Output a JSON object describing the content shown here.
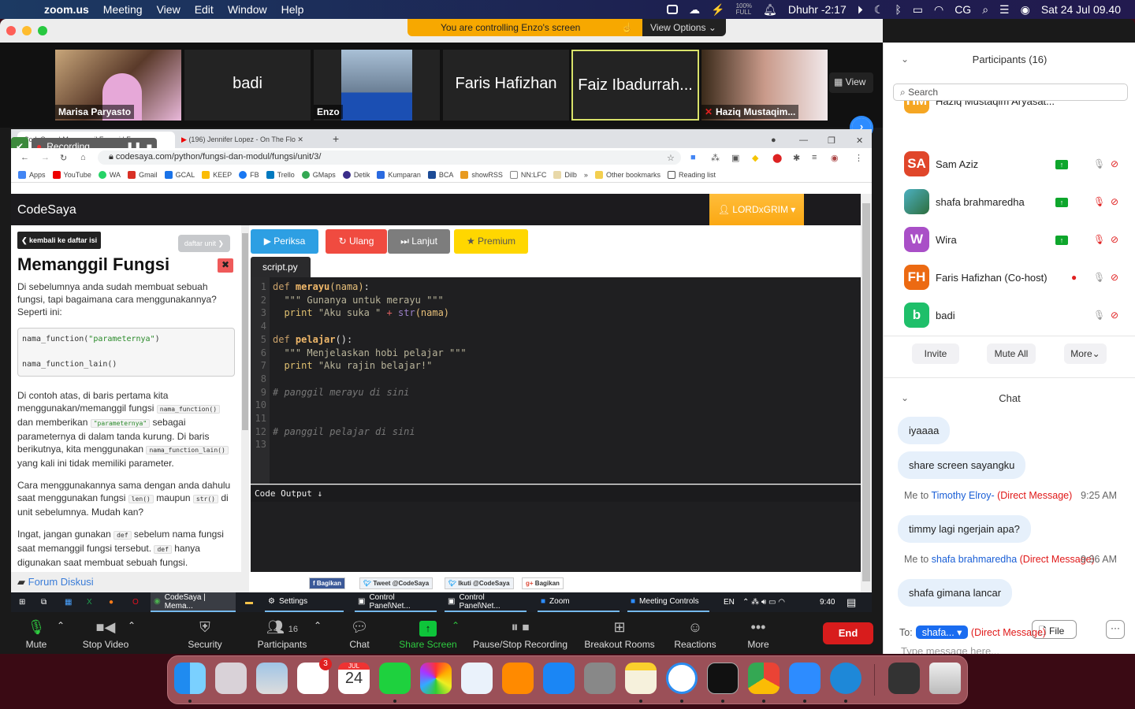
{
  "menubar": {
    "app": "zoom.us",
    "items": [
      "Meeting",
      "View",
      "Edit",
      "Window",
      "Help"
    ],
    "battery_small": [
      "100%",
      "FULL"
    ],
    "prayer": "Dhuhr -2:17",
    "user_initials": "CG",
    "datetime": "Sat 24 Jul  09.40"
  },
  "zoom": {
    "control_banner": "You are controlling Enzo's screen",
    "view_options": "View Options",
    "view_button": "View",
    "gallery": [
      {
        "name": "Marisa Paryasto",
        "type": "video"
      },
      {
        "name": "badi",
        "type": "name"
      },
      {
        "name": "Enzo",
        "type": "image"
      },
      {
        "name": "Faris Hafizhan",
        "type": "name"
      },
      {
        "name": "Faiz Ibadurrah...",
        "type": "name",
        "active": true
      },
      {
        "name": "Haziq Mustaqim...",
        "type": "video",
        "muted": true
      }
    ],
    "controls": {
      "mute": "Mute",
      "stop_video": "Stop Video",
      "security": "Security",
      "participants": "Participants",
      "participants_count": "16",
      "chat": "Chat",
      "share_screen": "Share Screen",
      "recording": "Pause/Stop Recording",
      "breakout": "Breakout Rooms",
      "reactions": "Reactions",
      "more": "More",
      "end": "End"
    }
  },
  "browser": {
    "tabs": [
      {
        "title": "CodeSaya | Memanggil Fungsi | F"
      },
      {
        "title": "(196) Jennifer Lopez - On The Flo"
      }
    ],
    "recording": "Recording...",
    "url": "codesaya.com/python/fungsi-dan-modul/fungsi/unit/3/",
    "bookmarks": [
      "Apps",
      "YouTube",
      "WA",
      "Gmail",
      "GCAL",
      "KEEP",
      "FB",
      "Trello",
      "GMaps",
      "Detik",
      "Kumparan",
      "BCA",
      "showRSS",
      "NN:LFC",
      "Dilb",
      "»",
      "Other bookmarks",
      "Reading list"
    ]
  },
  "codesaya": {
    "brand": "CodeSaya",
    "user": "LORDxGRIM",
    "back": "❮ kembali ke daftar isi",
    "unit_list": "daftar unit ❯",
    "title": "Memanggil Fungsi",
    "p1": "Di sebelumnya anda sudah membuat sebuah fungsi, tapi bagaimana cara menggunakannya? Seperti ini:",
    "example_line1_fn": "nama_function(",
    "example_line1_str": "\"parameternya\"",
    "example_line1_end": ")",
    "example_line2": "nama_function_lain()",
    "p2_a": "Di contoh atas, di baris pertama kita menggunakan/memanggil fungsi ",
    "p2_code1": "nama_function()",
    "p2_b": " dan memberikan ",
    "p2_code2": "\"parameternya\"",
    "p2_c": " sebagai parameternya di dalam tanda kurung. Di baris berikutnya, kita menggunakan ",
    "p2_code3": "nama_function_lain()",
    "p2_d": " yang kali ini tidak memiliki parameter.",
    "p3_a": "Cara menggunakannya sama dengan anda dahulu saat menggunakan fungsi ",
    "p3_code1": "len()",
    "p3_b": " maupun ",
    "p3_code2": "str()",
    "p3_c": " di unit sebelumnya. Mudah kan?",
    "p4_a": "Ingat, jangan gunakan ",
    "p4_code1": "def",
    "p4_b": " sebelum nama fungsi saat memanggil fungsi tersebut. ",
    "p4_code2": "def",
    "p4_c": " hanya digunakan saat membuat sebuah fungsi.",
    "forum": "Forum Diskusi",
    "buttons": {
      "check": "▶ Periksa",
      "reset": "↻ Ulang",
      "next": "⏭ Lanjut",
      "premium": "★ Premium"
    },
    "file_tab": "script.py",
    "line_numbers": [
      "1",
      "2",
      "3",
      "4",
      "5",
      "6",
      "7",
      "8",
      "9",
      "10",
      "11",
      "12",
      "13"
    ],
    "output_header": "Code Output ↓",
    "share": [
      "Bagikan",
      "Tweet @CodeSaya",
      "Ikuti @CodeSaya",
      "Bagikan"
    ]
  },
  "taskbar": {
    "items": [
      "CodeSaya | Mema...",
      "Settings",
      "Control Panel\\Net...",
      "Control Panel\\Net...",
      "Zoom",
      "Meeting Controls"
    ],
    "lang": "EN",
    "time": "9:40"
  },
  "participants": {
    "title": "Participants (16)",
    "search_placeholder": "Search",
    "list": [
      {
        "initials": "HM",
        "name": "Haziq Mustaqim Aryasat...",
        "color": "#f5a623"
      },
      {
        "initials": "SA",
        "name": "Sam Aziz",
        "color": "#e0462a"
      },
      {
        "initials": "",
        "name": "shafa brahmaredha",
        "color": "#3aa0a0"
      },
      {
        "initials": "W",
        "name": "Wira",
        "color": "#a94fc7"
      },
      {
        "initials": "FH",
        "name": "Faris Hafizhan (Co-host)",
        "color": "#ec6a12"
      },
      {
        "initials": "b",
        "name": "badi",
        "color": "#1fbf6a"
      }
    ],
    "buttons": {
      "invite": "Invite",
      "mute_all": "Mute All",
      "more": "More"
    }
  },
  "chat": {
    "title": "Chat",
    "messages": [
      {
        "text": "iyaaaa"
      },
      {
        "text": "share screen sayangku"
      },
      {
        "meta_me": "Me to ",
        "to": "Timothy Elroy-",
        "dm": " (Direct Message)",
        "time": "9:25 AM",
        "text": "timmy lagi ngerjain apa?"
      },
      {
        "meta_me": "Me to ",
        "to": "shafa brahmaredha",
        "dm": " (Direct Message)",
        "time": "9:36 AM",
        "text": "shafa gimana lancar"
      }
    ],
    "to_label": "To:",
    "to_value": "shafa...",
    "to_dm": "(Direct Message)",
    "file": "File",
    "more": "···",
    "placeholder": "Type message here..."
  },
  "dock": {
    "apps": [
      "Finder",
      "Launchpad",
      "Preview",
      "Reminders",
      "Calendar",
      "Messages",
      "Photos",
      "Keynote",
      "Books",
      "App Store",
      "System Preferences",
      "Notes",
      "Safari",
      "Terminal",
      "Chrome",
      "Zoom",
      "Hidden Bar",
      "Downloads",
      "Trash"
    ],
    "reminders_badge": "3",
    "calendar_month": "JUL",
    "calendar_day": "24"
  }
}
